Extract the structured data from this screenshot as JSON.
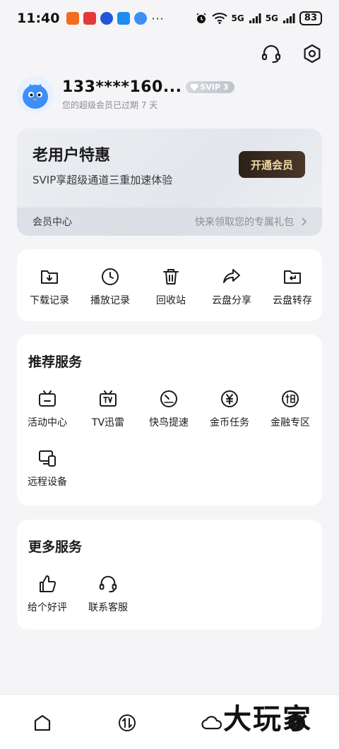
{
  "status_bar": {
    "time": "11:40",
    "more": "···",
    "network_1": "5G",
    "network_2": "5G",
    "battery": "83"
  },
  "profile": {
    "name": "133****160...",
    "badge": "SVIP 3",
    "subtitle": "您的超级会员已过期 7 天"
  },
  "vip_card": {
    "title": "老用户特惠",
    "desc": "SVIP享超级通道三重加速体验",
    "button": "开通会员",
    "footer_left": "会员中心",
    "footer_right": "快来领取您的专属礼包"
  },
  "quick_actions": [
    {
      "label": "下载记录",
      "icon": "download-folder-icon"
    },
    {
      "label": "播放记录",
      "icon": "clock-icon"
    },
    {
      "label": "回收站",
      "icon": "trash-icon"
    },
    {
      "label": "云盘分享",
      "icon": "share-arrow-icon"
    },
    {
      "label": "云盘转存",
      "icon": "transfer-folder-icon"
    }
  ],
  "recommended": {
    "title": "推荐服务",
    "items": [
      {
        "label": "活动中心",
        "icon": "activity-tv-icon"
      },
      {
        "label": "TV迅雷",
        "icon": "tv-icon"
      },
      {
        "label": "快鸟提速",
        "icon": "speedometer-icon"
      },
      {
        "label": "金币任务",
        "icon": "coin-icon"
      },
      {
        "label": "金融专区",
        "icon": "loan-icon"
      },
      {
        "label": "远程设备",
        "icon": "remote-device-icon"
      }
    ]
  },
  "more_services": {
    "title": "更多服务",
    "items": [
      {
        "label": "给个好评",
        "icon": "thumbs-up-icon"
      },
      {
        "label": "联系客服",
        "icon": "headset-icon"
      }
    ]
  },
  "watermark": "大玩家"
}
